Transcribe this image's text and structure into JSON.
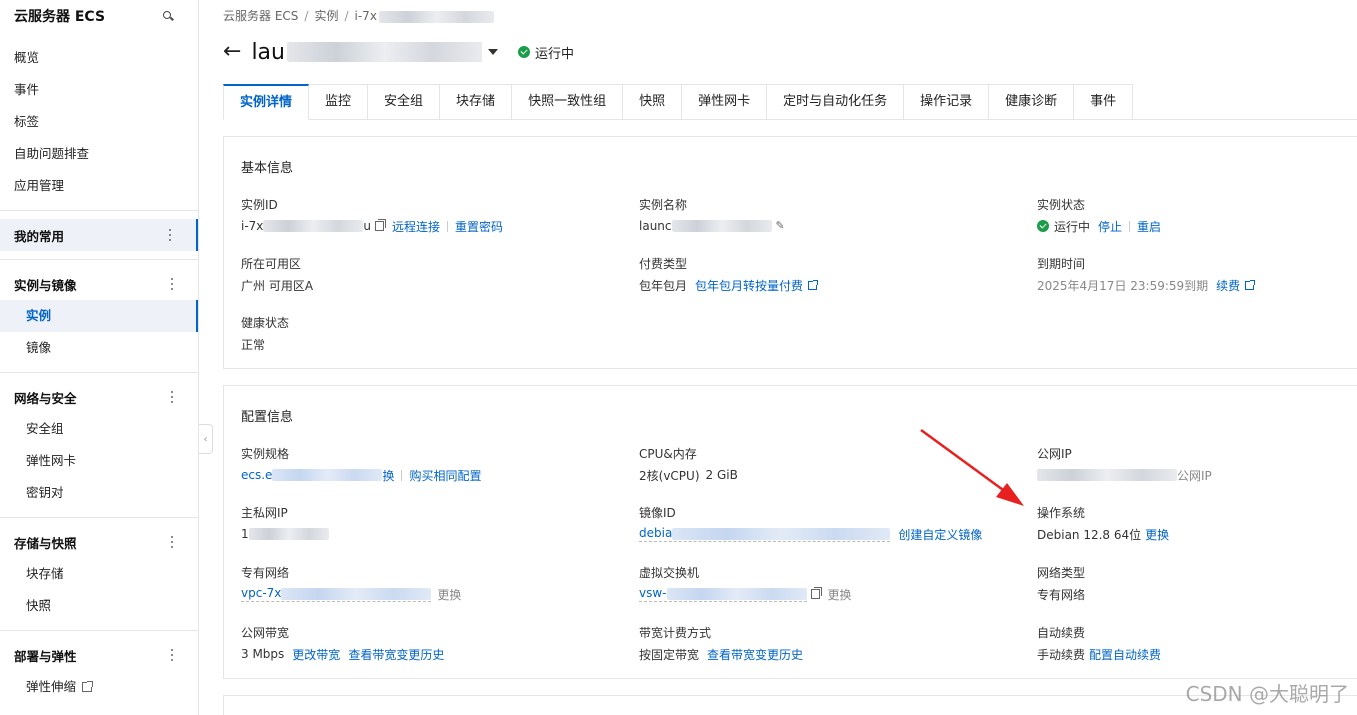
{
  "sidebar": {
    "title": "云服务器 ECS",
    "search_icon": "search-icon",
    "top_items": [
      "概览",
      "事件",
      "标签",
      "自助问题排查",
      "应用管理"
    ],
    "favorites": "我的常用",
    "groups": [
      {
        "label": "实例与镜像",
        "items": [
          "实例",
          "镜像"
        ]
      },
      {
        "label": "网络与安全",
        "items": [
          "安全组",
          "弹性网卡",
          "密钥对"
        ]
      },
      {
        "label": "存储与快照",
        "items": [
          "块存储",
          "快照"
        ]
      },
      {
        "label": "部署与弹性",
        "items": [
          "弹性伸缩"
        ]
      }
    ],
    "collapse_glyph": "‹"
  },
  "breadcrumb": {
    "root": "云服务器 ECS",
    "section": "实例",
    "instance_prefix": "i-7x"
  },
  "header": {
    "back_glyph": "←",
    "title_prefix": "lau",
    "status": "运行中"
  },
  "tabs": [
    "实例详情",
    "监控",
    "安全组",
    "块存储",
    "快照一致性组",
    "快照",
    "弹性网卡",
    "定时与自动化任务",
    "操作记录",
    "健康诊断",
    "事件"
  ],
  "basic": {
    "title": "基本信息",
    "instance_id": {
      "label": "实例ID",
      "prefix": "i-7x",
      "suffix": "u",
      "remote": "远程连接",
      "reset_pw": "重置密码"
    },
    "instance_name": {
      "label": "实例名称",
      "prefix": "launc"
    },
    "instance_status": {
      "label": "实例状态",
      "value": "运行中",
      "stop": "停止",
      "restart": "重启"
    },
    "zone": {
      "label": "所在可用区",
      "value": "广州 可用区A"
    },
    "billing": {
      "label": "付费类型",
      "value": "包年包月",
      "convert": "包年包月转按量付费"
    },
    "expire": {
      "label": "到期时间",
      "value": "2025年4月17日 23:59:59到期",
      "renew": "续费"
    },
    "health": {
      "label": "健康状态",
      "value": "正常"
    }
  },
  "config": {
    "title": "配置信息",
    "spec": {
      "label": "实例规格",
      "prefix": "ecs.e",
      "suffix": "换",
      "buy_same": "购买相同配置"
    },
    "cpu_mem": {
      "label": "CPU&内存",
      "cpu": "2核(vCPU)",
      "mem": "2 GiB"
    },
    "public_ip": {
      "label": "公网IP",
      "suffix": "公网IP"
    },
    "private_ip": {
      "label": "主私网IP",
      "prefix": "1"
    },
    "image_id": {
      "label": "镜像ID",
      "prefix": "debia",
      "create_custom": "创建自定义镜像"
    },
    "os": {
      "label": "操作系统",
      "value": "Debian 12.8 64位",
      "change": "更换"
    },
    "vpc": {
      "label": "专有网络",
      "prefix": "vpc-7x",
      "change": "更换"
    },
    "vswitch": {
      "label": "虚拟交换机",
      "prefix": "vsw-",
      "change": "更换"
    },
    "network_type": {
      "label": "网络类型",
      "value": "专有网络"
    },
    "bandwidth": {
      "label": "公网带宽",
      "value": "3 Mbps",
      "change": "更改带宽",
      "history": "查看带宽变更历史"
    },
    "bw_billing": {
      "label": "带宽计费方式",
      "value": "按固定带宽",
      "history": "查看带宽变更历史"
    },
    "auto_renew": {
      "label": "自动续费",
      "value": "手动续费",
      "config": "配置自动续费"
    }
  },
  "annotation": {
    "color": "#e8201f"
  },
  "watermark": "CSDN @大聪明了",
  "colors": {
    "accent": "#0064c8",
    "running": "#1c9d4a"
  }
}
